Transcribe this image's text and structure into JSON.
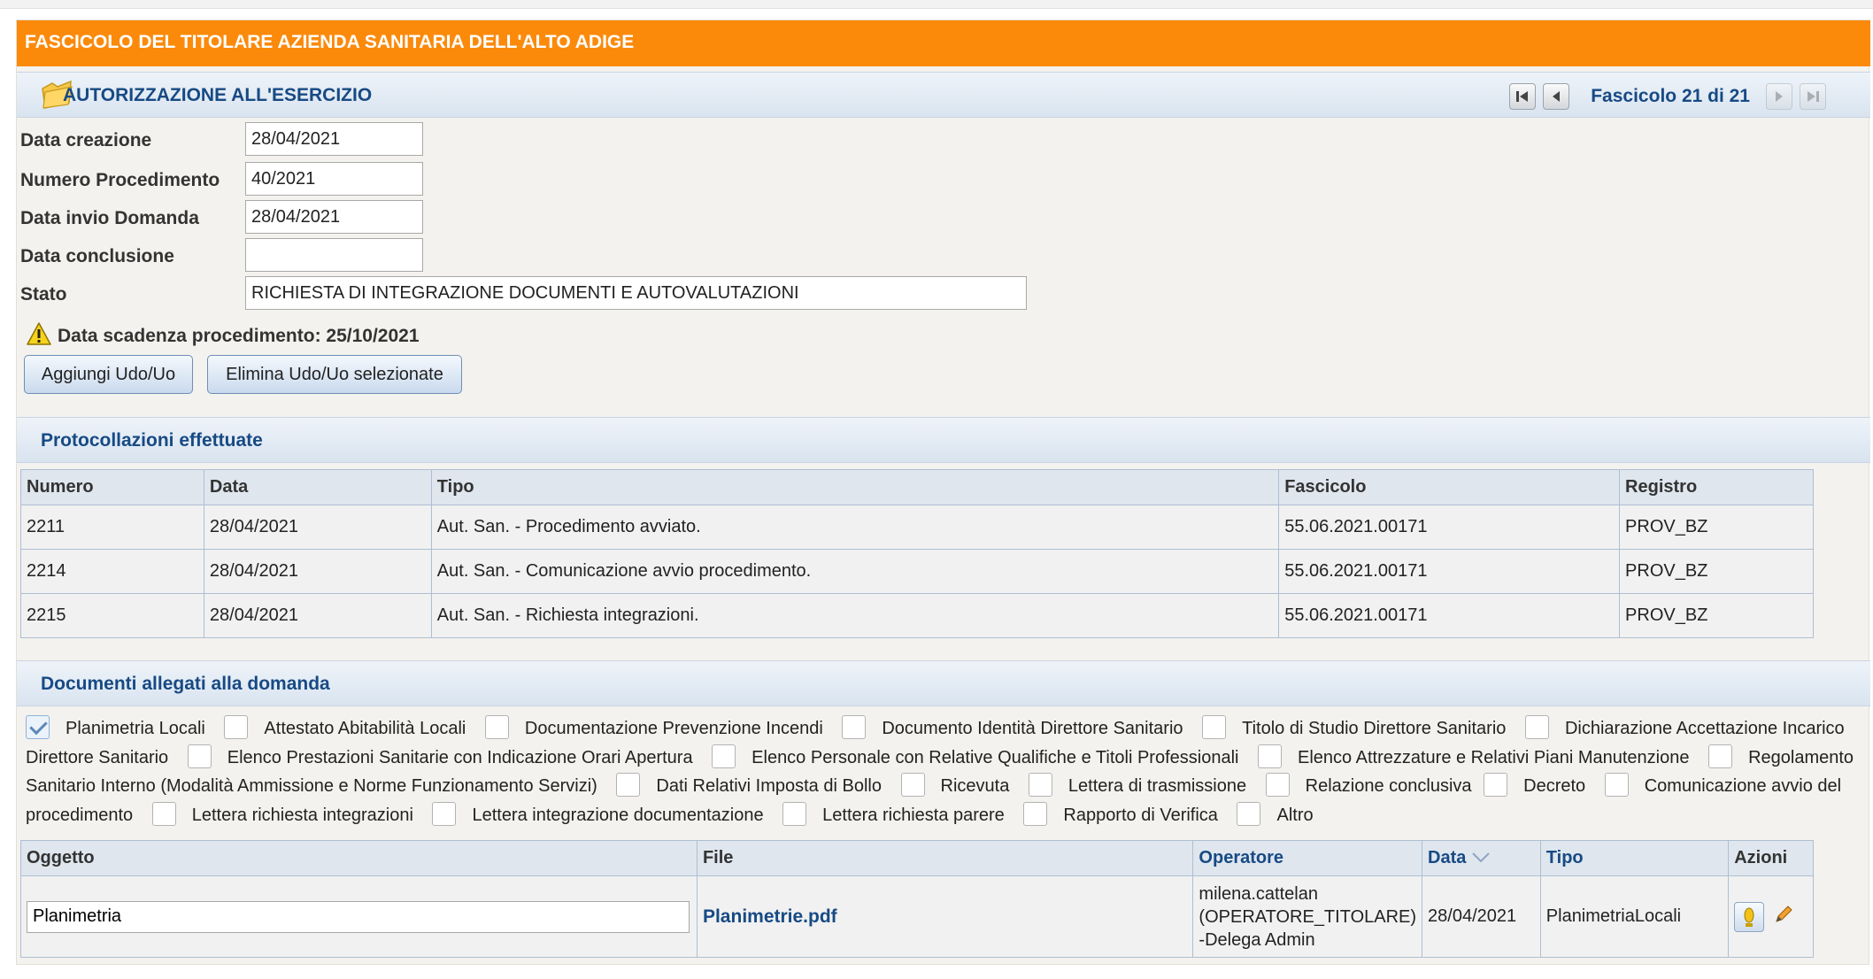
{
  "header": {
    "title": "FASCICOLO DEL TITOLARE AZIENDA SANITARIA DELL'ALTO ADIGE",
    "section_title": "AUTORIZZAZIONE ALL'ESERCIZIO",
    "pager_text": "Fascicolo 21 di 21"
  },
  "form": {
    "data_creazione_label": "Data creazione",
    "data_creazione_value": "28/04/2021",
    "numero_label": "Numero Procedimento",
    "numero_value": "40/2021",
    "invio_label": "Data invio Domanda",
    "invio_value": "28/04/2021",
    "conclusione_label": "Data conclusione",
    "conclusione_value": "",
    "stato_label": "Stato",
    "stato_value": "RICHIESTA DI INTEGRAZIONE DOCUMENTI E AUTOVALUTAZIONI"
  },
  "warning": "Data scadenza procedimento: 25/10/2021",
  "buttons": {
    "add": "Aggiungi Udo/Uo",
    "delete": "Elimina Udo/Uo selezionate"
  },
  "protocol": {
    "title": "Protocollazioni effettuate",
    "headers": [
      "Numero",
      "Data",
      "Tipo",
      "Fascicolo",
      "Registro"
    ],
    "rows": [
      [
        "2211",
        "28/04/2021",
        "Aut. San. - Procedimento avviato.",
        "55.06.2021.00171",
        "PROV_BZ"
      ],
      [
        "2214",
        "28/04/2021",
        "Aut. San. - Comunicazione avvio procedimento.",
        "55.06.2021.00171",
        "PROV_BZ"
      ],
      [
        "2215",
        "28/04/2021",
        "Aut. San. - Richiesta integrazioni.",
        "55.06.2021.00171",
        "PROV_BZ"
      ]
    ]
  },
  "documents": {
    "title": "Documenti allegati alla domanda",
    "checkboxes": [
      {
        "label": "Planimetria Locali",
        "checked": true
      },
      {
        "label": "Attestato Abitabilità Locali",
        "checked": false
      },
      {
        "label": "Documentazione Prevenzione Incendi",
        "checked": false
      },
      {
        "label": "Documento Identità Direttore Sanitario",
        "checked": false
      },
      {
        "label": "Titolo di Studio Direttore Sanitario",
        "checked": false
      },
      {
        "label": "Dichiarazione Accettazione Incarico Direttore Sanitario",
        "checked": false
      },
      {
        "label": "Elenco Prestazioni Sanitarie con Indicazione Orari Apertura",
        "checked": false
      },
      {
        "label": "Elenco Personale con Relative Qualifiche e Titoli Professionali",
        "checked": false
      },
      {
        "label": "Elenco Attrezzature e Relativi Piani Manutenzione",
        "checked": false
      },
      {
        "label": "Regolamento Sanitario Interno (Modalità Ammissione e Norme Funzionamento Servizi)",
        "checked": false
      },
      {
        "label": "Dati Relativi Imposta di Bollo",
        "checked": false
      },
      {
        "label": "Ricevuta",
        "checked": false
      },
      {
        "label": "Lettera di trasmissione",
        "checked": false
      },
      {
        "label": "Relazione conclusiva",
        "checked": false
      },
      {
        "label": "Decreto",
        "checked": false
      },
      {
        "label": "Comunicazione avvio del procedimento",
        "checked": false
      },
      {
        "label": "Lettera richiesta integrazioni",
        "checked": false
      },
      {
        "label": "Lettera integrazione documentazione",
        "checked": false
      },
      {
        "label": "Lettera richiesta parere",
        "checked": false
      },
      {
        "label": "Rapporto di Verifica",
        "checked": false
      },
      {
        "label": "Altro",
        "checked": false
      }
    ],
    "headers": {
      "oggetto": "Oggetto",
      "file": "File",
      "operatore": "Operatore",
      "data": "Data",
      "tipo": "Tipo",
      "azioni": "Azioni"
    },
    "rows": [
      {
        "oggetto": "Planimetria",
        "file": "Planimetrie.pdf",
        "operatore_line1": "milena.cattelan",
        "operatore_line2": "(OPERATORE_TITOLARE)",
        "operatore_line3": "-Delega Admin",
        "data": "28/04/2021",
        "tipo": "PlanimetriaLocali"
      }
    ]
  },
  "icons": {
    "folder": "folder-icon",
    "first": "first-page-icon",
    "prev": "prev-page-icon",
    "next": "next-page-icon",
    "last": "last-page-icon",
    "warning": "warning-icon",
    "download": "download-icon",
    "edit": "pencil-icon",
    "sort": "sort-desc-icon"
  },
  "colors": {
    "accent": "#fb8a0b",
    "link": "#174a84"
  }
}
